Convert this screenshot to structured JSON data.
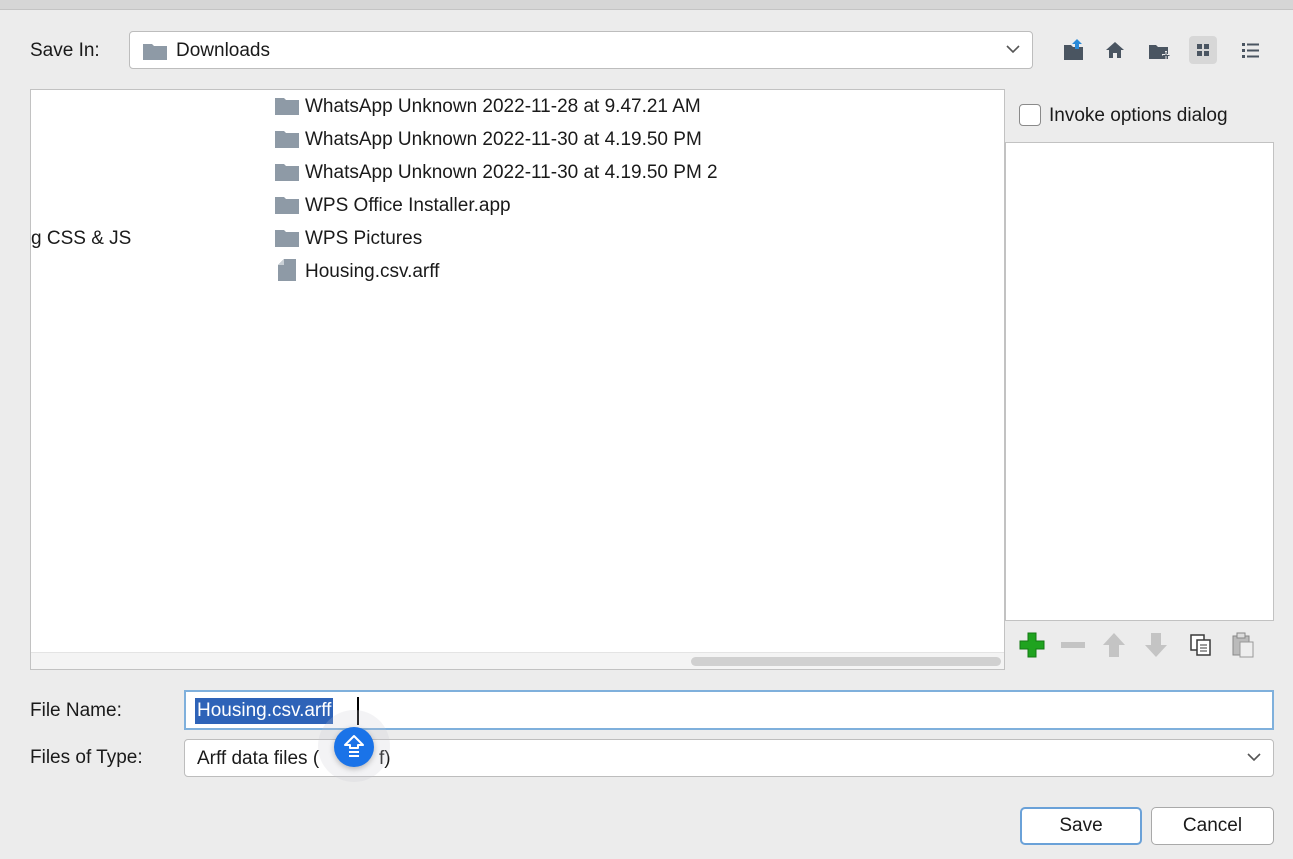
{
  "save_in": {
    "label": "Save In:",
    "value": "Downloads"
  },
  "toolbar": {
    "icons": [
      "up-folder-icon",
      "home-icon",
      "new-folder-icon",
      "list-view-icon",
      "details-view-icon"
    ],
    "selected": "list-view-icon"
  },
  "file_list": {
    "left_column_partial": "g CSS & JS",
    "items": [
      {
        "name": "WhatsApp Unknown 2022-11-28 at 9.47.21 AM",
        "type": "folder"
      },
      {
        "name": "WhatsApp Unknown 2022-11-30 at 4.19.50 PM",
        "type": "folder"
      },
      {
        "name": "WhatsApp Unknown 2022-11-30 at 4.19.50 PM 2",
        "type": "folder"
      },
      {
        "name": "WPS Office Installer.app",
        "type": "folder"
      },
      {
        "name": "WPS Pictures",
        "type": "folder"
      },
      {
        "name": "Housing.csv.arff",
        "type": "file"
      }
    ]
  },
  "options": {
    "invoke_label": "Invoke options dialog",
    "invoke_checked": false,
    "buttons": [
      "add-icon",
      "remove-icon",
      "move-up-icon",
      "move-down-icon",
      "copy-icon",
      "paste-icon"
    ]
  },
  "file_name": {
    "label": "File Name:",
    "value": "Housing.csv.arff"
  },
  "file_type": {
    "label": "Files of Type:",
    "value_visible_start": "Arff data files (",
    "value_visible_end": "f)"
  },
  "buttons": {
    "save": "Save",
    "cancel": "Cancel"
  },
  "colors": {
    "selection": "#2e63b8",
    "focus_border": "#7fb0dc",
    "folder": "#8e9aa6",
    "add_green": "#1fa31f",
    "float_button": "#1a73e8"
  }
}
